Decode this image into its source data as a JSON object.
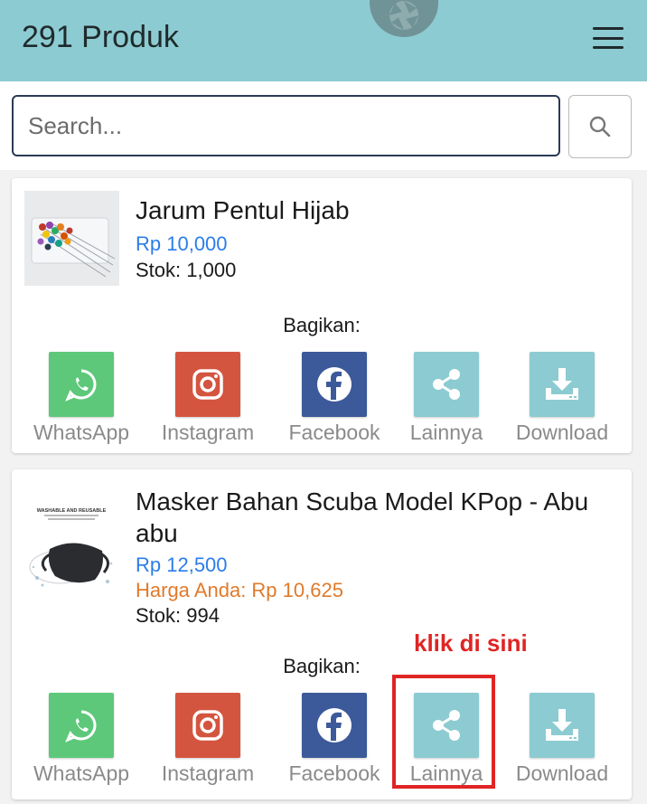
{
  "header": {
    "title": "291 Produk"
  },
  "search": {
    "placeholder": "Search..."
  },
  "products": [
    {
      "name": "Jarum Pentul Hijab",
      "price": "Rp 10,000",
      "stock": "Stok: 1,000",
      "share_label": "Bagikan:"
    },
    {
      "name": "Masker Bahan Scuba Model KPop - Abu abu",
      "thumb_text_1": "WASHABLE AND REUSABLE",
      "price": "Rp 12,500",
      "your_price": "Harga Anda: Rp 10,625",
      "stock": "Stok: 994",
      "share_label": "Bagikan:"
    }
  ],
  "share_buttons": {
    "whatsapp": "WhatsApp",
    "instagram": "Instagram",
    "facebook": "Facebook",
    "other": "Lainnya",
    "download": "Download"
  },
  "annotation": {
    "text": "klik di sini"
  },
  "colors": {
    "header": "#8ccbd1",
    "price": "#2b7de9",
    "your_price": "#e07a2b",
    "whatsapp": "#5dc87a",
    "instagram": "#d4553f",
    "facebook": "#3c5a9a",
    "annotation": "#e02424"
  }
}
